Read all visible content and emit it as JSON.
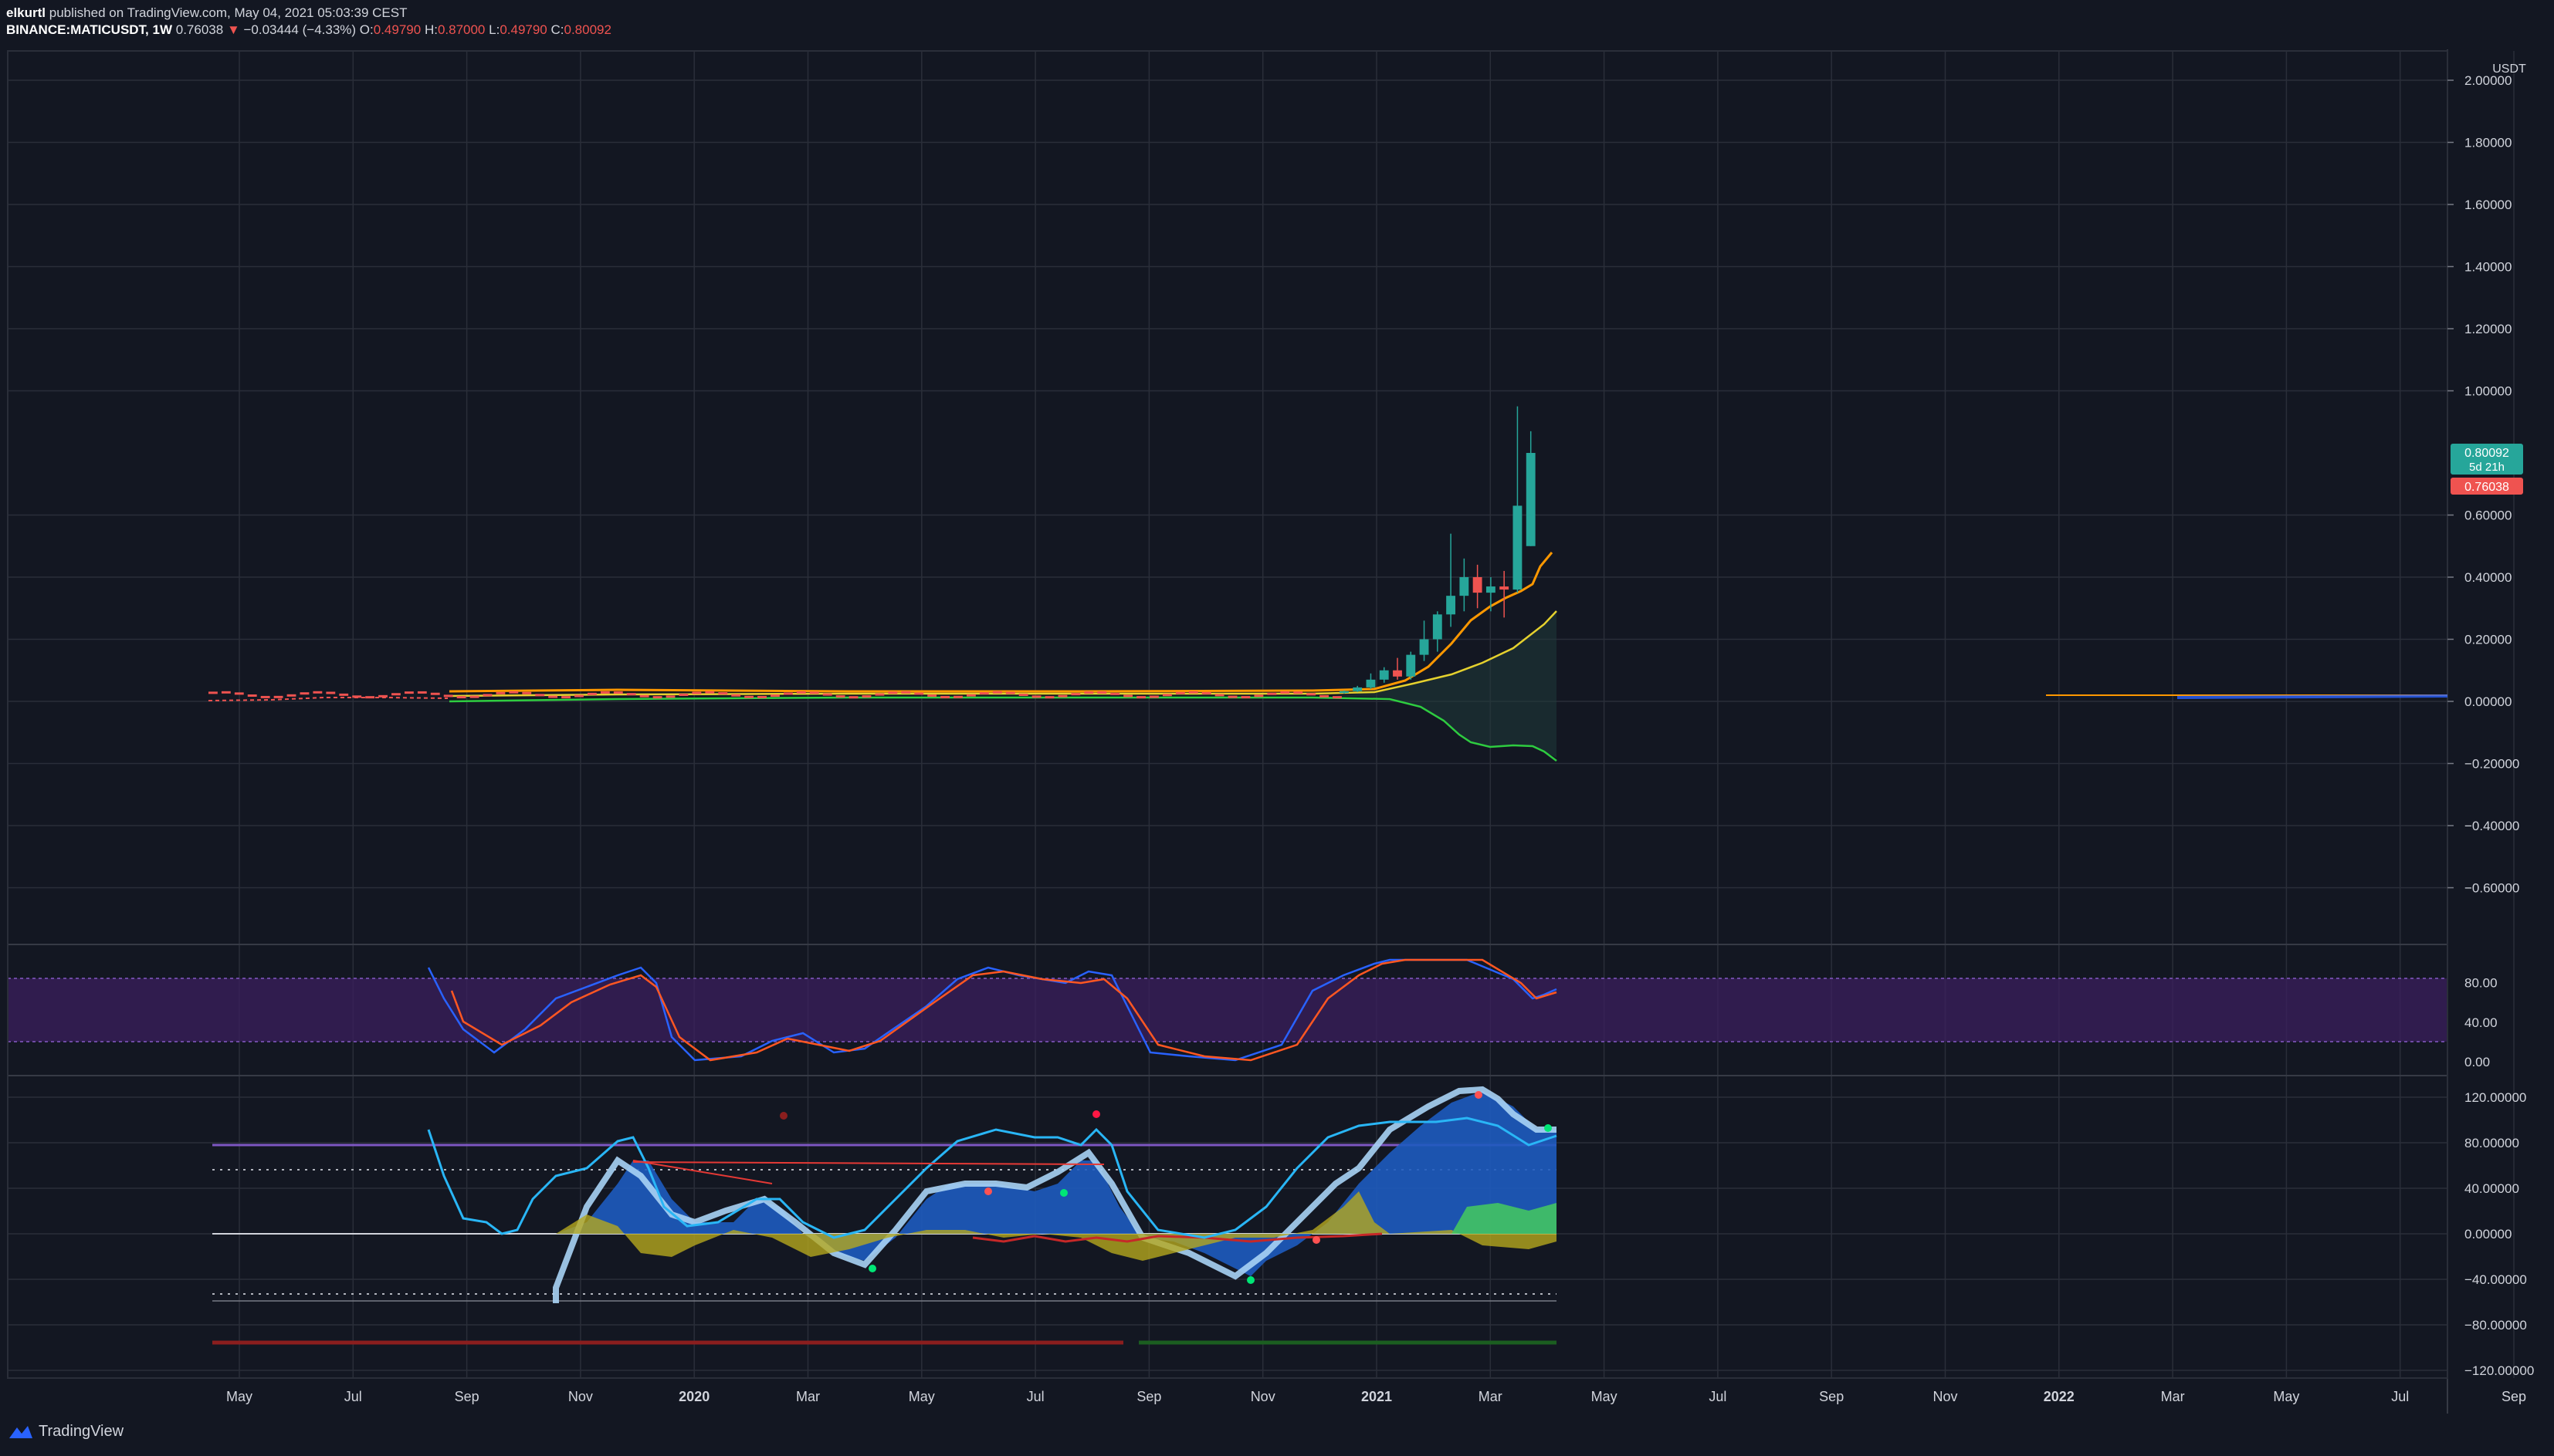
{
  "header": {
    "author": "elkurtl",
    "published_text": "published on TradingView.com, May 04, 2021 05:03:39 CEST",
    "symbol": "BINANCE:MATICUSDT, 1W",
    "last": "0.76038",
    "change_arrow": "▼",
    "change": "−0.03444 (−4.33%)",
    "o_label": "O:",
    "o": "0.49790",
    "h_label": "H:",
    "h": "0.87000",
    "l_label": "L:",
    "l": "0.49790",
    "c_label": "C:",
    "c": "0.80092"
  },
  "price_axis": {
    "currency": "USDT",
    "ticks": [
      "2.00000",
      "1.80000",
      "1.60000",
      "1.40000",
      "1.20000",
      "1.00000",
      "0.60000",
      "0.40000",
      "0.20000",
      "0.00000",
      "−0.20000",
      "−0.40000",
      "−0.60000"
    ],
    "tick_values": [
      2.0,
      1.8,
      1.6,
      1.4,
      1.2,
      1.0,
      0.6,
      0.4,
      0.2,
      0.0,
      -0.2,
      -0.4,
      -0.6
    ],
    "price_badge": "0.80092",
    "countdown_badge": "5d 21h",
    "last_badge": "0.76038"
  },
  "stoch_axis": {
    "ticks": [
      "80.00",
      "40.00",
      "0.00"
    ],
    "tick_values": [
      80,
      40,
      0
    ]
  },
  "osc_axis": {
    "ticks": [
      "120.00000",
      "80.00000",
      "40.00000",
      "0.00000",
      "−40.00000",
      "−80.00000",
      "−120.00000"
    ],
    "tick_values": [
      120,
      80,
      40,
      0,
      -40,
      -80,
      -120
    ]
  },
  "time_axis": {
    "labels": [
      "May",
      "Jul",
      "Sep",
      "Nov",
      "2020",
      "Mar",
      "May",
      "Jul",
      "Sep",
      "Nov",
      "2021",
      "Mar",
      "May",
      "Jul",
      "Sep",
      "Nov",
      "2022",
      "Mar",
      "May",
      "Jul",
      "Sep"
    ],
    "bold": [
      false,
      false,
      false,
      false,
      true,
      false,
      false,
      false,
      false,
      false,
      true,
      false,
      false,
      false,
      false,
      false,
      true,
      false,
      false,
      false,
      false
    ]
  },
  "chart_data": {
    "type": "candlestick",
    "symbol": "BINANCE:MATICUSDT",
    "interval": "1W",
    "ylim": [
      -0.7,
      2.05
    ],
    "candles_2021": [
      {
        "week": "2021-01-25",
        "o": 0.027,
        "h": 0.035,
        "l": 0.025,
        "c": 0.033
      },
      {
        "week": "2021-02-01",
        "o": 0.033,
        "h": 0.05,
        "l": 0.03,
        "c": 0.045
      },
      {
        "week": "2021-02-08",
        "o": 0.045,
        "h": 0.09,
        "l": 0.04,
        "c": 0.07
      },
      {
        "week": "2021-02-15",
        "o": 0.07,
        "h": 0.11,
        "l": 0.06,
        "c": 0.1
      },
      {
        "week": "2021-02-22",
        "o": 0.1,
        "h": 0.14,
        "l": 0.07,
        "c": 0.08
      },
      {
        "week": "2021-03-01",
        "o": 0.08,
        "h": 0.16,
        "l": 0.07,
        "c": 0.15
      },
      {
        "week": "2021-03-08",
        "o": 0.15,
        "h": 0.26,
        "l": 0.13,
        "c": 0.2
      },
      {
        "week": "2021-03-15",
        "o": 0.2,
        "h": 0.29,
        "l": 0.16,
        "c": 0.28
      },
      {
        "week": "2021-03-22",
        "o": 0.28,
        "h": 0.54,
        "l": 0.24,
        "c": 0.34
      },
      {
        "week": "2021-03-29",
        "o": 0.34,
        "h": 0.46,
        "l": 0.29,
        "c": 0.4
      },
      {
        "week": "2021-04-05",
        "o": 0.4,
        "h": 0.44,
        "l": 0.3,
        "c": 0.35
      },
      {
        "week": "2021-04-12",
        "o": 0.35,
        "h": 0.4,
        "l": 0.29,
        "c": 0.37
      },
      {
        "week": "2021-04-19",
        "o": 0.37,
        "h": 0.42,
        "l": 0.27,
        "c": 0.36
      },
      {
        "week": "2021-04-26",
        "o": 0.36,
        "h": 0.95,
        "l": 0.35,
        "c": 0.63
      },
      {
        "week": "2021-05-03",
        "o": 0.5,
        "h": 0.87,
        "l": 0.5,
        "c": 0.8
      }
    ],
    "stochastic": {
      "upper_band": 80,
      "lower_band": 20,
      "ylim": [
        0,
        100
      ]
    },
    "oscillator": {
      "ylim": [
        -130,
        130
      ],
      "upper_line": 80,
      "dotted_upper": 55,
      "dotted_lower": -55
    }
  }
}
